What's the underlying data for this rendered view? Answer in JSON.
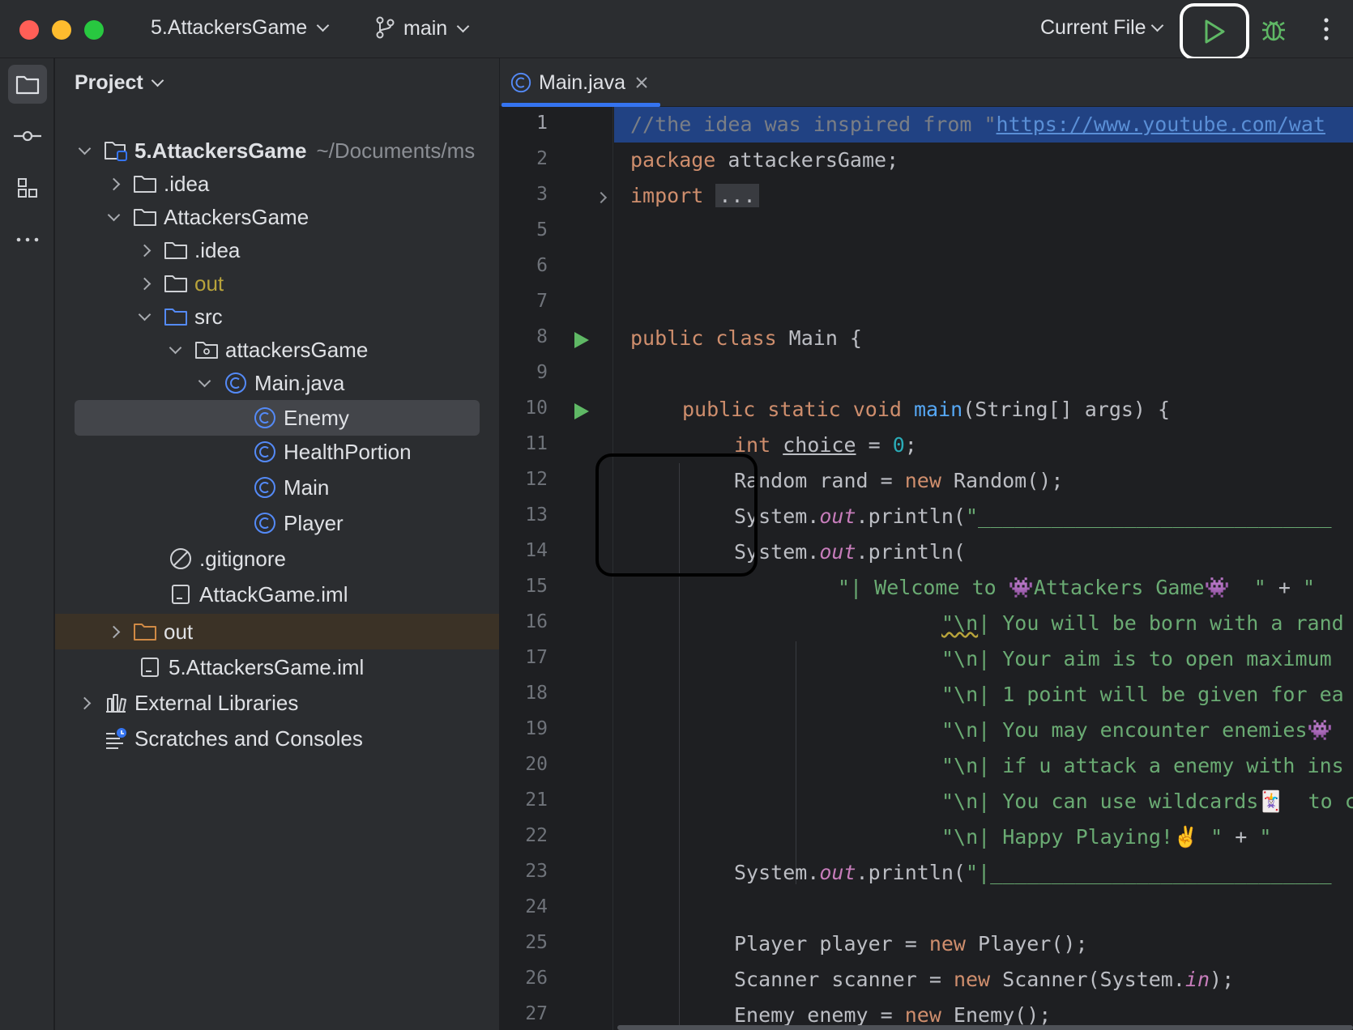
{
  "titlebar": {
    "project_name": "5.AttackersGame",
    "branch": "main",
    "run_config": "Current File",
    "traffic_colors": [
      "#ff5f57",
      "#febc2e",
      "#28c840"
    ]
  },
  "toolstrip": {
    "items": [
      "project-icon",
      "commit-icon",
      "structure-icon",
      "more-tools-icon"
    ]
  },
  "project_panel": {
    "title": "Project",
    "root_path": "~/Documents/ms",
    "tree": [
      {
        "label": "5.AttackersGame",
        "icon": "module-folder-icon",
        "expanded": true
      },
      {
        "label": ".idea",
        "icon": "folder-icon",
        "expanded": false
      },
      {
        "label": "AttackersGame",
        "icon": "folder-icon",
        "expanded": true
      },
      {
        "label": ".idea",
        "icon": "folder-icon",
        "expanded": false
      },
      {
        "label": "out",
        "icon": "folder-icon",
        "expanded": false
      },
      {
        "label": "src",
        "icon": "source-folder-icon",
        "expanded": true
      },
      {
        "label": "attackersGame",
        "icon": "package-icon",
        "expanded": true
      },
      {
        "label": "Main.java",
        "icon": "class-icon",
        "expanded": true
      },
      {
        "label": "Enemy",
        "icon": "class-icon"
      },
      {
        "label": "HealthPortion",
        "icon": "class-icon"
      },
      {
        "label": "Main",
        "icon": "class-icon"
      },
      {
        "label": "Player",
        "icon": "class-icon"
      },
      {
        "label": ".gitignore",
        "icon": "ignored-file-icon"
      },
      {
        "label": "AttackGame.iml",
        "icon": "iml-file-icon"
      },
      {
        "label": "out",
        "icon": "excluded-folder-icon",
        "expanded": false
      },
      {
        "label": "5.AttackersGame.iml",
        "icon": "iml-file-icon"
      },
      {
        "label": "External Libraries",
        "icon": "library-icon",
        "expanded": false
      },
      {
        "label": "Scratches and Consoles",
        "icon": "scratches-icon"
      }
    ]
  },
  "editor": {
    "tab_label": "Main.java",
    "line_numbers": [
      "1",
      "2",
      "3",
      "5",
      "6",
      "7",
      "8",
      "9",
      "10",
      "11",
      "12",
      "13",
      "14",
      "15",
      "16",
      "17",
      "18",
      "19",
      "20",
      "21",
      "22",
      "23",
      "24",
      "25",
      "26",
      "27"
    ],
    "code": {
      "l1": "//the idea was inspired from \"",
      "l1_link": "https://www.youtube.com/wat",
      "l2_kw": "package",
      "l2_rest": " attackersGame;",
      "l3_kw": "import",
      "l3_fold": "...",
      "l8_kw": "public class",
      "l8_rest": " Main {",
      "l10_kw": "public static void",
      "l10_fn": "main",
      "l10_rest": "(String[] args) {",
      "l11_kw": "int",
      "l11_var": "choice",
      "l11_eq": " = ",
      "l11_num": "0",
      "l11_end": ";",
      "l12_a": "Random rand = ",
      "l12_kw": "new",
      "l12_b": " Random();",
      "sys": "System.",
      "out": "out",
      "println": ".println(",
      "l13_str": "\"_____________________________",
      "l15_str": "\"| Welcome to 👾Attackers Game👾  \"",
      "plus": " + ",
      "l15_str2": "\"",
      "l16_nl": "\"\\n",
      "l16_str": "| You will be born with a rand",
      "l17_str": "\"\\n| Your aim is to open maximum",
      "l18_str": "\"\\n| 1 point will be given for ea",
      "l19_str": "\"\\n| You may encounter enemies👾",
      "l20_str": "\"\\n| if u attack a enemy with ins",
      "l21_str": "\"\\n| You can use wildcards🃏  to c",
      "l22_str": "\"\\n| Happy Playing!✌️ \"",
      "l23_str": "\"|____________________________",
      "l25_a": "Player player = ",
      "l25_kw": "new",
      "l25_b": " Player();",
      "l26_a": "Scanner scanner = ",
      "l26_kw": "new",
      "l26_b": " Scanner(System.",
      "l26_in": "in",
      "l26_c": ");",
      "l27_a": "Enemy enemy = ",
      "l27_kw": "new",
      "l27_b": " Enemy();"
    }
  },
  "colors": {
    "accent": "#3574f0",
    "run_green": "#5fb865",
    "keyword": "#cf8e6d",
    "string": "#6aab73",
    "function": "#56a8f5"
  }
}
